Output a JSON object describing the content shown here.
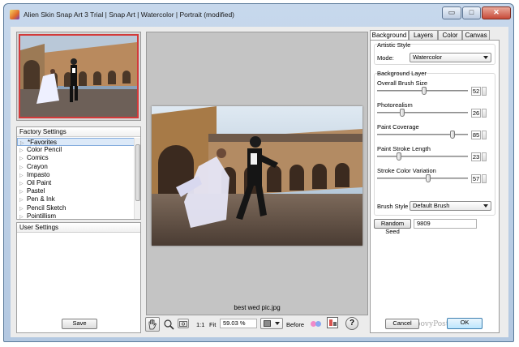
{
  "window": {
    "title": "Alien Skin Snap Art 3 Trial | Snap Art | Watercolor | Portrait (modified)",
    "minimize_glyph": "▭",
    "maximize_glyph": "□",
    "close_glyph": "✕"
  },
  "presets": {
    "header": "Factory Settings",
    "items": [
      {
        "label": "*Favorites",
        "selected": true
      },
      {
        "label": "Color Pencil"
      },
      {
        "label": "Comics"
      },
      {
        "label": "Crayon"
      },
      {
        "label": "Impasto"
      },
      {
        "label": "Oil Paint"
      },
      {
        "label": "Pastel"
      },
      {
        "label": "Pen & Ink"
      },
      {
        "label": "Pencil Sketch"
      },
      {
        "label": "Pointillism"
      }
    ],
    "expander_glyph": "▷"
  },
  "user_settings": {
    "header": "User Settings"
  },
  "preview": {
    "filename": "best wed pic.jpg"
  },
  "tabs": [
    {
      "label": "Background",
      "active": true
    },
    {
      "label": "Layers"
    },
    {
      "label": "Color"
    },
    {
      "label": "Canvas"
    }
  ],
  "background_tab": {
    "artistic_style": {
      "title": "Artistic Style",
      "mode_label": "Mode:",
      "mode_value": "Watercolor"
    },
    "background_layer": {
      "title": "Background Layer",
      "sliders": [
        {
          "label": "Overall Brush Size",
          "value": "52",
          "fraction": 0.52
        },
        {
          "label": "Photorealism",
          "value": "26",
          "fraction": 0.26
        },
        {
          "label": "Paint Coverage",
          "value": "85",
          "fraction": 0.85
        },
        {
          "label": "Paint Stroke Length",
          "value": "23",
          "fraction": 0.23
        },
        {
          "label": "Stroke Color Variation",
          "value": "57",
          "fraction": 0.57
        }
      ],
      "brush_style_label": "Brush Style",
      "brush_style_value": "Default Brush"
    },
    "random_seed_label": "Random Seed",
    "random_seed_value": "9809"
  },
  "toolbar": {
    "save_label": "Save",
    "zoom_1to1": "1:1",
    "fit_label": "Fit",
    "zoom_value": "59.03 %",
    "before_label": "Before",
    "cancel_label": "Cancel",
    "ok_label": "OK",
    "help_glyph": "?"
  },
  "watermark": "groovyPost.com",
  "colors": {
    "selection_red": "#d23a3a",
    "titlebar": "#c7d8ec",
    "close_button": "#c74a38"
  }
}
